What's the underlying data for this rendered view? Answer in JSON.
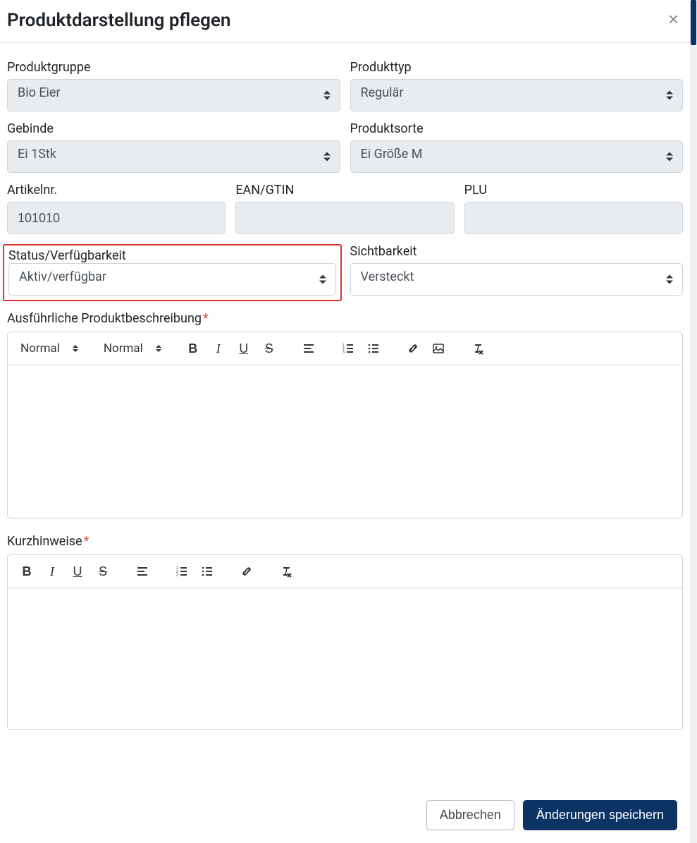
{
  "header": {
    "title": "Produktdarstellung pflegen"
  },
  "fields": {
    "productGroup": {
      "label": "Produktgruppe",
      "value": "Bio Eier"
    },
    "productType": {
      "label": "Produkttyp",
      "value": "Regulär"
    },
    "container": {
      "label": "Gebinde",
      "value": "Ei 1Stk"
    },
    "productSort": {
      "label": "Produktsorte",
      "value": "Ei Größe M"
    },
    "articleNo": {
      "label": "Artikelnr.",
      "value": "101010"
    },
    "ean": {
      "label": "EAN/GTIN",
      "value": ""
    },
    "plu": {
      "label": "PLU",
      "value": ""
    },
    "status": {
      "label": "Status/Verfügbarkeit",
      "value": "Aktiv/verfügbar"
    },
    "visibility": {
      "label": "Sichtbarkeit",
      "value": "Versteckt"
    },
    "description": {
      "label": "Ausführliche Produktbeschreibung"
    },
    "shortNotes": {
      "label": "Kurzhinweise"
    }
  },
  "toolbar": {
    "styleSelect1": "Normal",
    "styleSelect2": "Normal"
  },
  "footer": {
    "cancel": "Abbrechen",
    "save": "Änderungen speichern"
  }
}
